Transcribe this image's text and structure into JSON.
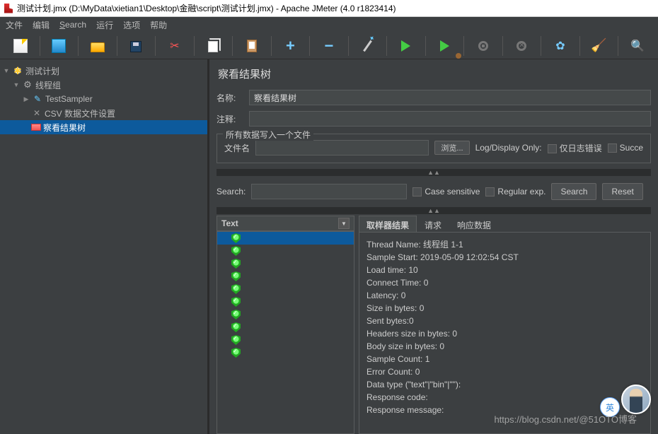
{
  "title": "测试计划.jmx (D:\\MyData\\xietian1\\Desktop\\金融\\script\\测试计划.jmx) - Apache JMeter (4.0 r1823414)",
  "menu": {
    "file": "文件",
    "edit": "编辑",
    "search": "Search",
    "run": "运行",
    "options": "选项",
    "help": "帮助"
  },
  "tree": {
    "plan": "测试计划",
    "threadgroup": "线程组",
    "sampler": "TestSampler",
    "csv": "CSV 数据文件设置",
    "results": "察看结果树"
  },
  "panel": {
    "title": "察看结果树",
    "name_label": "名称:",
    "name_value": "察看结果树",
    "comment_label": "注释:",
    "comment_value": "",
    "fieldset_legend": "所有数据写入一个文件",
    "filename_label": "文件名",
    "filename_value": "",
    "browse": "浏览...",
    "logdisplay": "Log/Display Only:",
    "errors_only": "仅日志错误",
    "successes": "Succe",
    "search_label": "Search:",
    "search_value": "",
    "case_sensitive": "Case sensitive",
    "regex": "Regular exp.",
    "search_btn": "Search",
    "reset_btn": "Reset",
    "renderer": "Text",
    "tabs": {
      "sampler": "取样器结果",
      "request": "请求",
      "response": "响应数据"
    },
    "details": [
      "Thread Name: 线程组 1-1",
      "Sample Start: 2019-05-09 12:02:54 CST",
      "Load time: 10",
      "Connect Time: 0",
      "Latency: 0",
      "Size in bytes: 0",
      "Sent bytes:0",
      "Headers size in bytes: 0",
      "Body size in bytes: 0",
      "Sample Count: 1",
      "Error Count: 0",
      "Data type (\"text\"|\"bin\"|\"\"):",
      "Response code:",
      "Response message:"
    ]
  },
  "watermark": "https://blog.csdn.net/@51OTO博客",
  "lang": "英"
}
